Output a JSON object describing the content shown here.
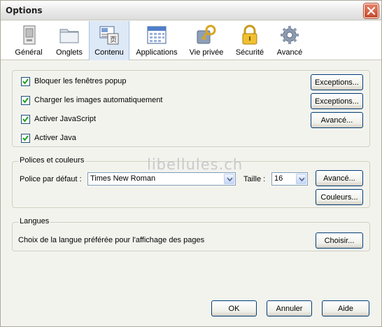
{
  "window": {
    "title": "Options"
  },
  "toolbar": {
    "tabs": [
      {
        "label": "Général",
        "icon": "general-panel-icon"
      },
      {
        "label": "Onglets",
        "icon": "tabs-folder-icon"
      },
      {
        "label": "Contenu",
        "icon": "content-icon",
        "selected": true
      },
      {
        "label": "Applications",
        "icon": "applications-calendar-icon"
      },
      {
        "label": "Vie privée",
        "icon": "privacy-key-icon"
      },
      {
        "label": "Sécurité",
        "icon": "security-lock-icon"
      },
      {
        "label": "Avancé",
        "icon": "advanced-gear-icon"
      }
    ]
  },
  "content": {
    "block_popups": {
      "label": "Bloquer les fenêtres popup",
      "checked": true,
      "button": "Exceptions..."
    },
    "load_images": {
      "label": "Charger les images automatiquement",
      "checked": true,
      "button": "Exceptions..."
    },
    "enable_js": {
      "label": "Activer JavaScript",
      "checked": true,
      "button": "Avancé..."
    },
    "enable_java": {
      "label": "Activer Java",
      "checked": true
    }
  },
  "fonts": {
    "legend": "Polices et couleurs",
    "default_font_label": "Police par défaut :",
    "default_font_value": "Times New Roman",
    "size_label": "Taille :",
    "size_value": "16",
    "advanced_button": "Avancé...",
    "colors_button": "Couleurs..."
  },
  "languages": {
    "legend": "Langues",
    "description": "Choix de la langue préférée pour l'affichage des pages",
    "choose_button": "Choisir..."
  },
  "watermark": "libellules.ch",
  "footer": {
    "ok": "OK",
    "cancel": "Annuler",
    "help": "Aide"
  },
  "colors": {
    "accent": "#dde9f7",
    "dialog_bg": "#f3f3ee",
    "button_border": "#003c74"
  }
}
